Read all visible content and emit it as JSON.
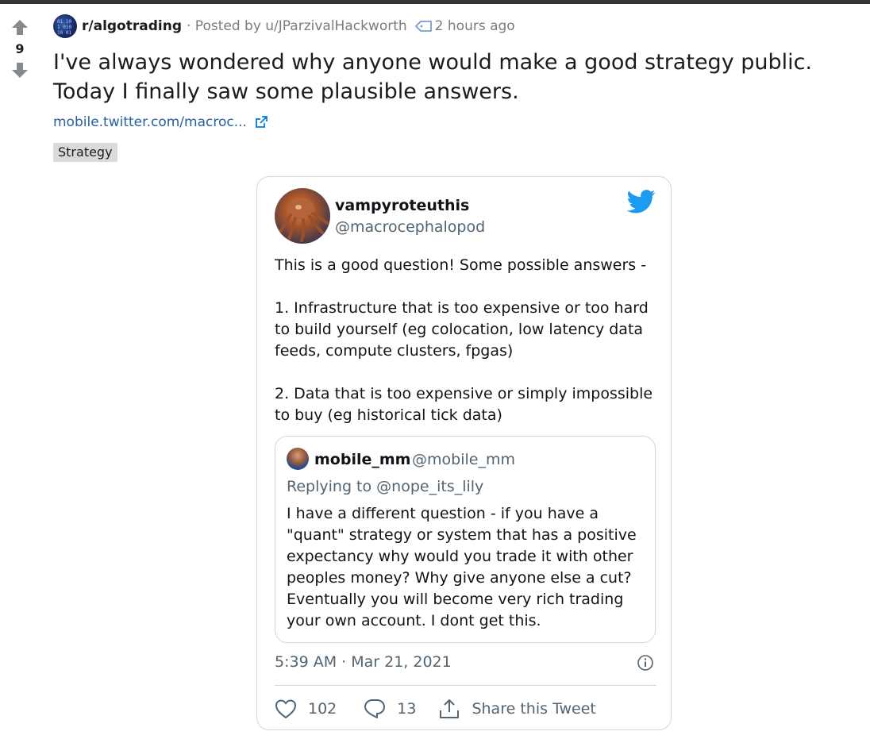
{
  "post": {
    "vote_count": "9",
    "subreddit": "r/algotrading",
    "posted_by": "· Posted by u/JParzivalHackworth",
    "time": "2 hours ago",
    "title": "I've always wondered why anyone would make a good strategy public. Today I finally saw some plausible answers.",
    "link_text": "mobile.twitter.com/macroc...",
    "flair": "Strategy"
  },
  "tweet": {
    "display_name": "vampyroteuthis",
    "handle": "@macrocephalopod",
    "body": "This is a good question! Some possible answers -\n\n1. Infrastructure that is too expensive or too hard to build yourself (eg colocation, low latency data feeds, compute clusters, fpgas)\n\n2. Data that is too expensive or simply impossible to buy (eg historical tick data)",
    "timestamp": "5:39 AM · Mar 21, 2021",
    "likes": "102",
    "replies": "13",
    "share_label": "Share this Tweet",
    "quoted": {
      "display_name": "mobile_mm",
      "handle": "@mobile_mm",
      "replying_prefix": "Replying to",
      "replying_to": "@nope_its_lily",
      "body": "I have a different question - if you have a \"quant\" strategy or system that has a positive expectancy why would you trade it with other peoples money? Why give anyone else a cut? Eventually you will become very rich trading your own account. I dont get this."
    }
  },
  "icons": {
    "upvote": "upvote-arrow-icon",
    "downvote": "downvote-arrow-icon",
    "tag": "tag-icon",
    "external_link": "external-link-icon",
    "twitter": "twitter-bird-icon",
    "info": "info-icon",
    "like": "heart-icon",
    "reply": "speech-bubble-icon",
    "share": "share-icon"
  },
  "colors": {
    "twitter_blue": "#1d9bf0",
    "link_blue": "#24619e",
    "muted": "#536471"
  }
}
